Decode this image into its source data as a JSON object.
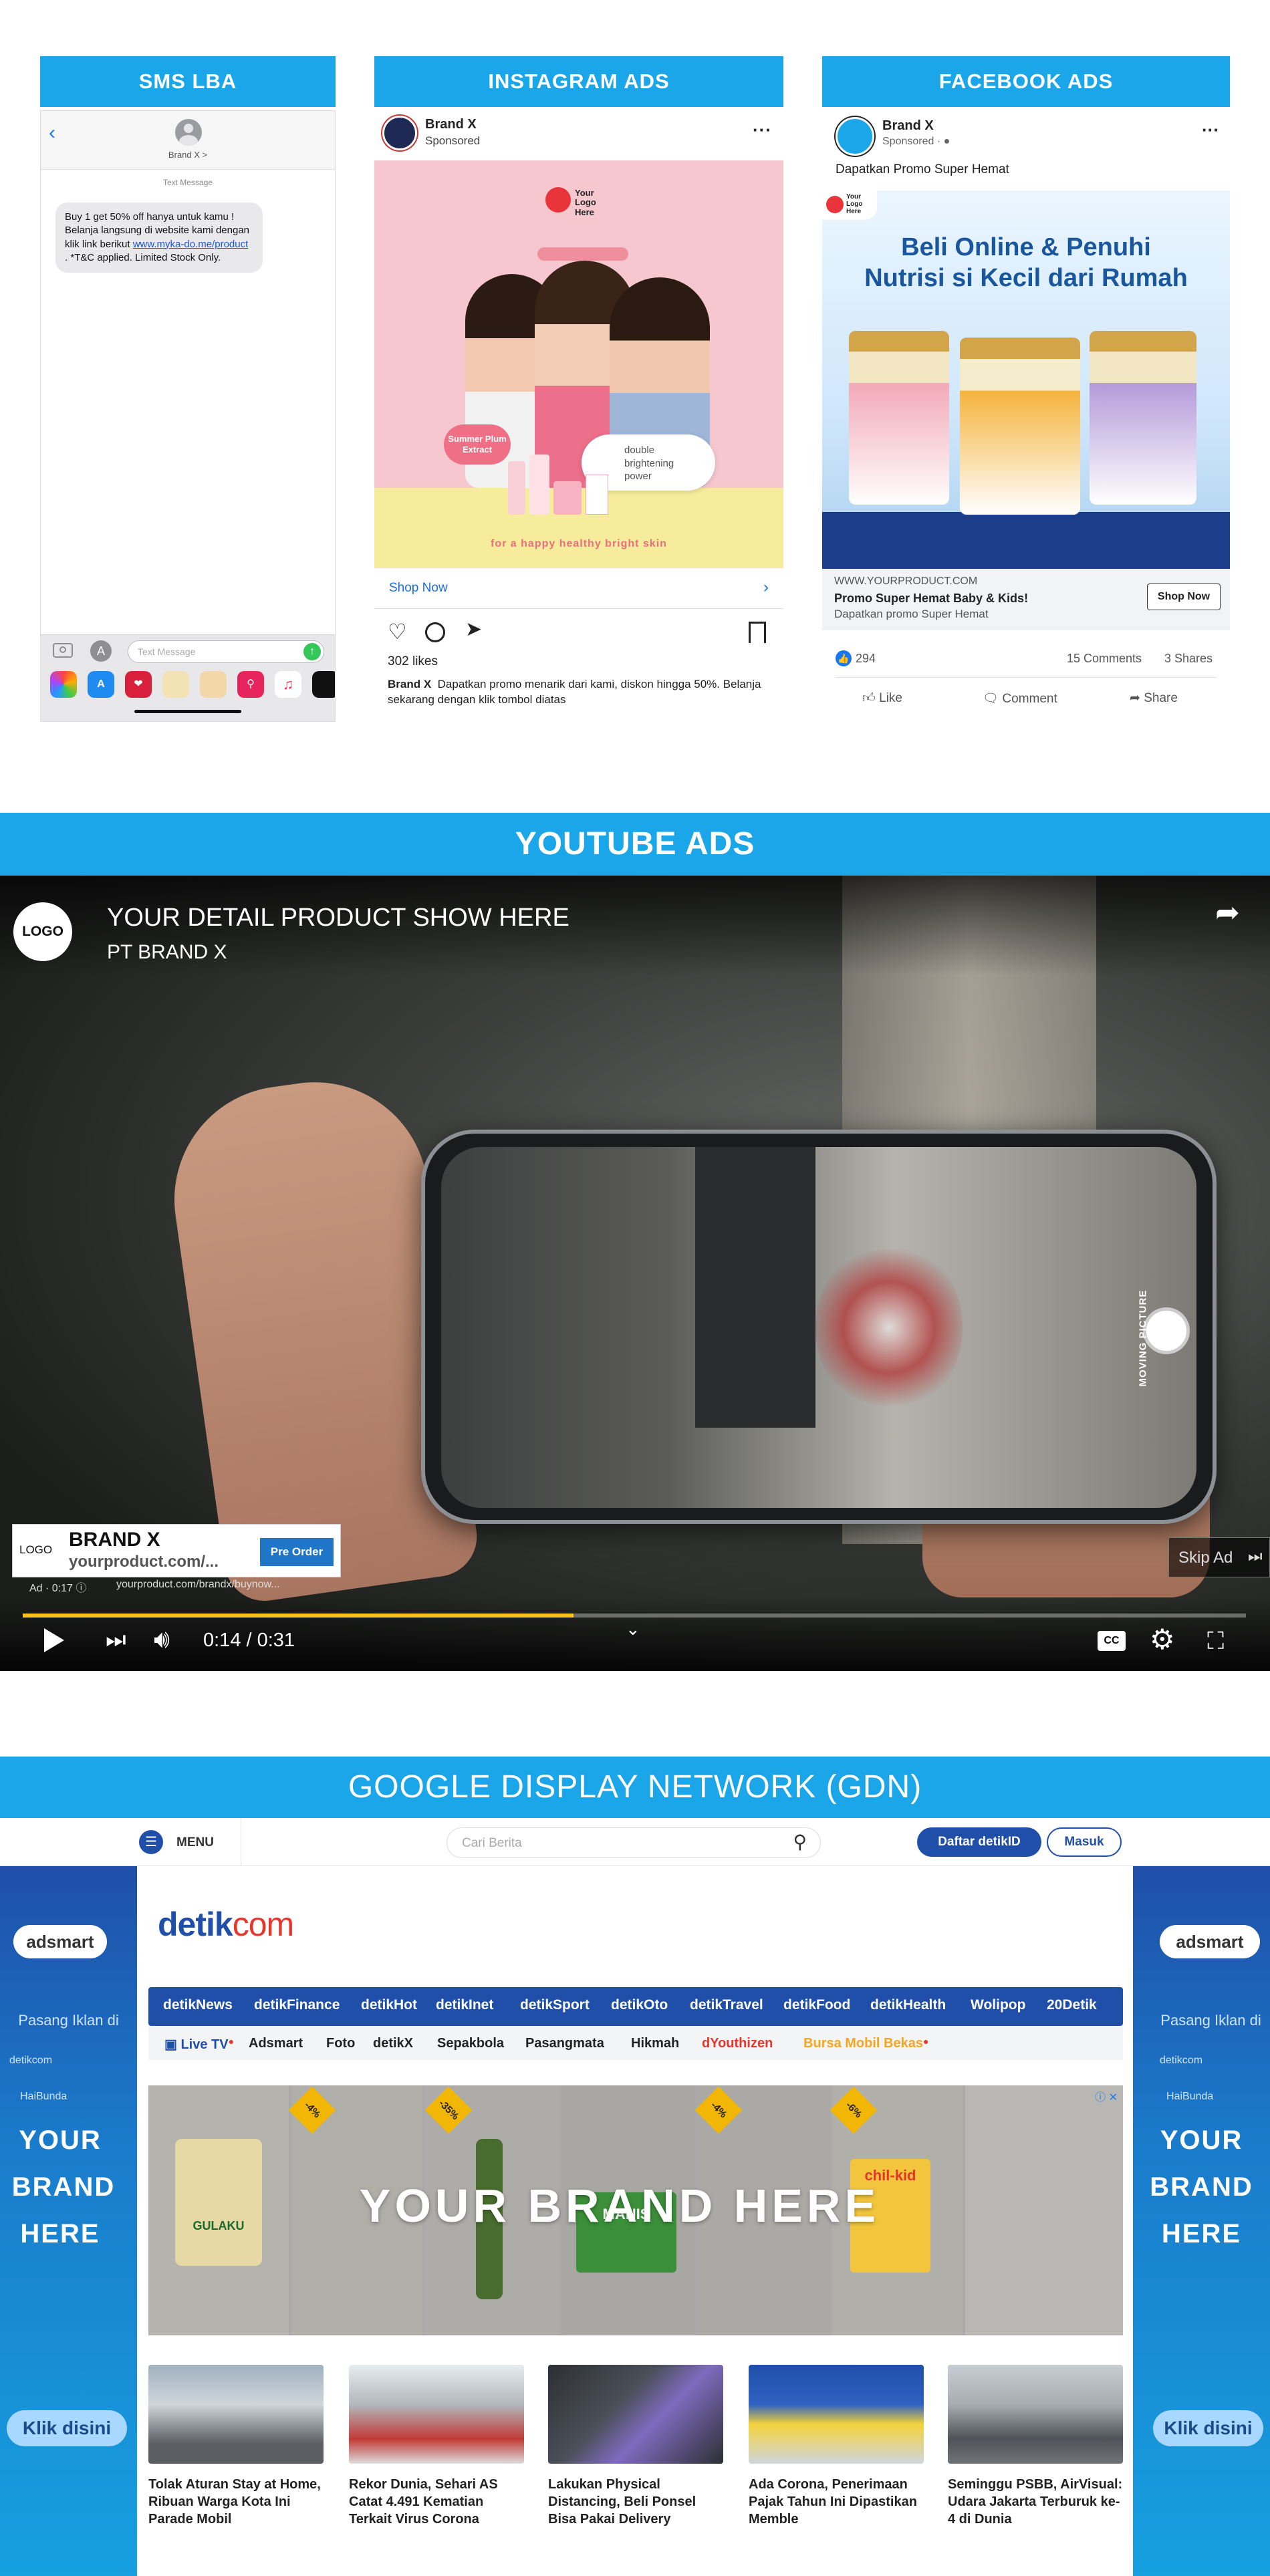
{
  "sections": {
    "sms_title": "SMS LBA",
    "instagram_title": "INSTAGRAM ADS",
    "facebook_title": "FACEBOOK ADS",
    "youtube_title": "YOUTUBE ADS",
    "gdn_title": "GOOGLE DISPLAY NETWORK (GDN)"
  },
  "sms": {
    "contact": "Brand X",
    "contact_chevron": ">",
    "label": "Text Message",
    "message_prefix": "Buy 1 get 50% off hanya untuk kamu ! Belanja langsung di website kami dengan klik link berikut ",
    "link": "www.myka-do.me/product",
    "message_suffix": " . *T&C applied. Limited Stock Only.",
    "input_placeholder": "Text Message"
  },
  "instagram": {
    "brand": "Brand X",
    "sponsored": "Sponsored",
    "logo_text": "Your Logo Here",
    "badge_text": "Summer Plum Extract",
    "bubble_text": "double brightening power",
    "tagline": "for a happy healthy bright skin",
    "cta": "Shop Now",
    "likes": "302 likes",
    "caption_brand": "Brand X",
    "caption": "Dapatkan promo menarik dari kami, diskon hingga 50%. Belanja sekarang dengan klik tombol diatas"
  },
  "facebook": {
    "brand": "Brand X",
    "sponsored": "Sponsored",
    "post_text": "Dapatkan Promo Super Hemat",
    "logo_text": "Your Logo Here",
    "headline_line1": "Beli Online & Penuhi",
    "headline_line2": "Nutrisi si Kecil dari Rumah",
    "url": "WWW.YOURPRODUCT.COM",
    "link_title": "Promo Super Hemat Baby & Kids!",
    "link_desc": "Dapatkan promo Super Hemat",
    "cta": "Shop Now",
    "reactions": "294",
    "comments": "15 Comments",
    "shares": "3 Shares",
    "like": "Like",
    "comment": "Comment",
    "share": "Share"
  },
  "youtube": {
    "logo": "LOGO",
    "title": "YOUR DETAIL PRODUCT SHOW HERE",
    "channel": "PT BRAND X",
    "moving_picture": "MOVING PICTURE",
    "ad_logo": "LOGO",
    "ad_brand": "BRAND X",
    "ad_url": "yourproduct.com/...",
    "ad_cta": "Pre Order",
    "ad_label": "Ad",
    "ad_time": "0:17",
    "ad_full_url": "yourproduct.com/brandx/buynow...",
    "skip": "Skip Ad",
    "time": "0:14 / 0:31",
    "progress": 0.45
  },
  "gdn": {
    "menu": "MENU",
    "search_placeholder": "Cari Berita",
    "register": "Daftar detikID",
    "login": "Masuk",
    "logo_main": "detik",
    "logo_suffix": "com",
    "nav": [
      "detikNews",
      "detikFinance",
      "detikHot",
      "detikInet",
      "detikSport",
      "detikOto",
      "detikTravel",
      "detikFood",
      "detikHealth",
      "Wolipop",
      "20Detik"
    ],
    "subnav": [
      "Live TV",
      "Adsmart",
      "Foto",
      "detikX",
      "Sepakbola",
      "Pasangmata",
      "Hikmah",
      "dYouthizen",
      "Bursa Mobil Bekas"
    ],
    "banner_text": "YOUR BRAND HERE",
    "discounts": [
      "-4%",
      "-35%",
      "-4%",
      "-6%"
    ],
    "product_labels": [
      "GULAKU",
      "MANIS",
      "chil-kid"
    ],
    "side_brand": "adsmart",
    "side_text": [
      "YOUR",
      "BRAND",
      "HERE"
    ],
    "side_pre": "Pasang Iklan di",
    "side_small": [
      "detikcom",
      "HaiBunda"
    ],
    "side_cta": "Klik disini",
    "news": [
      "Tolak Aturan Stay at Home, Ribuan Warga Kota Ini Parade Mobil",
      "Rekor Dunia, Sehari AS Catat 4.491 Kematian Terkait Virus Corona",
      "Lakukan Physical Distancing, Beli Ponsel Bisa Pakai Delivery",
      "Ada Corona, Penerimaan Pajak Tahun Ini Dipastikan Memble",
      "Seminggu PSBB, AirVisual: Udara Jakarta Terburuk ke-4 di Dunia"
    ]
  }
}
